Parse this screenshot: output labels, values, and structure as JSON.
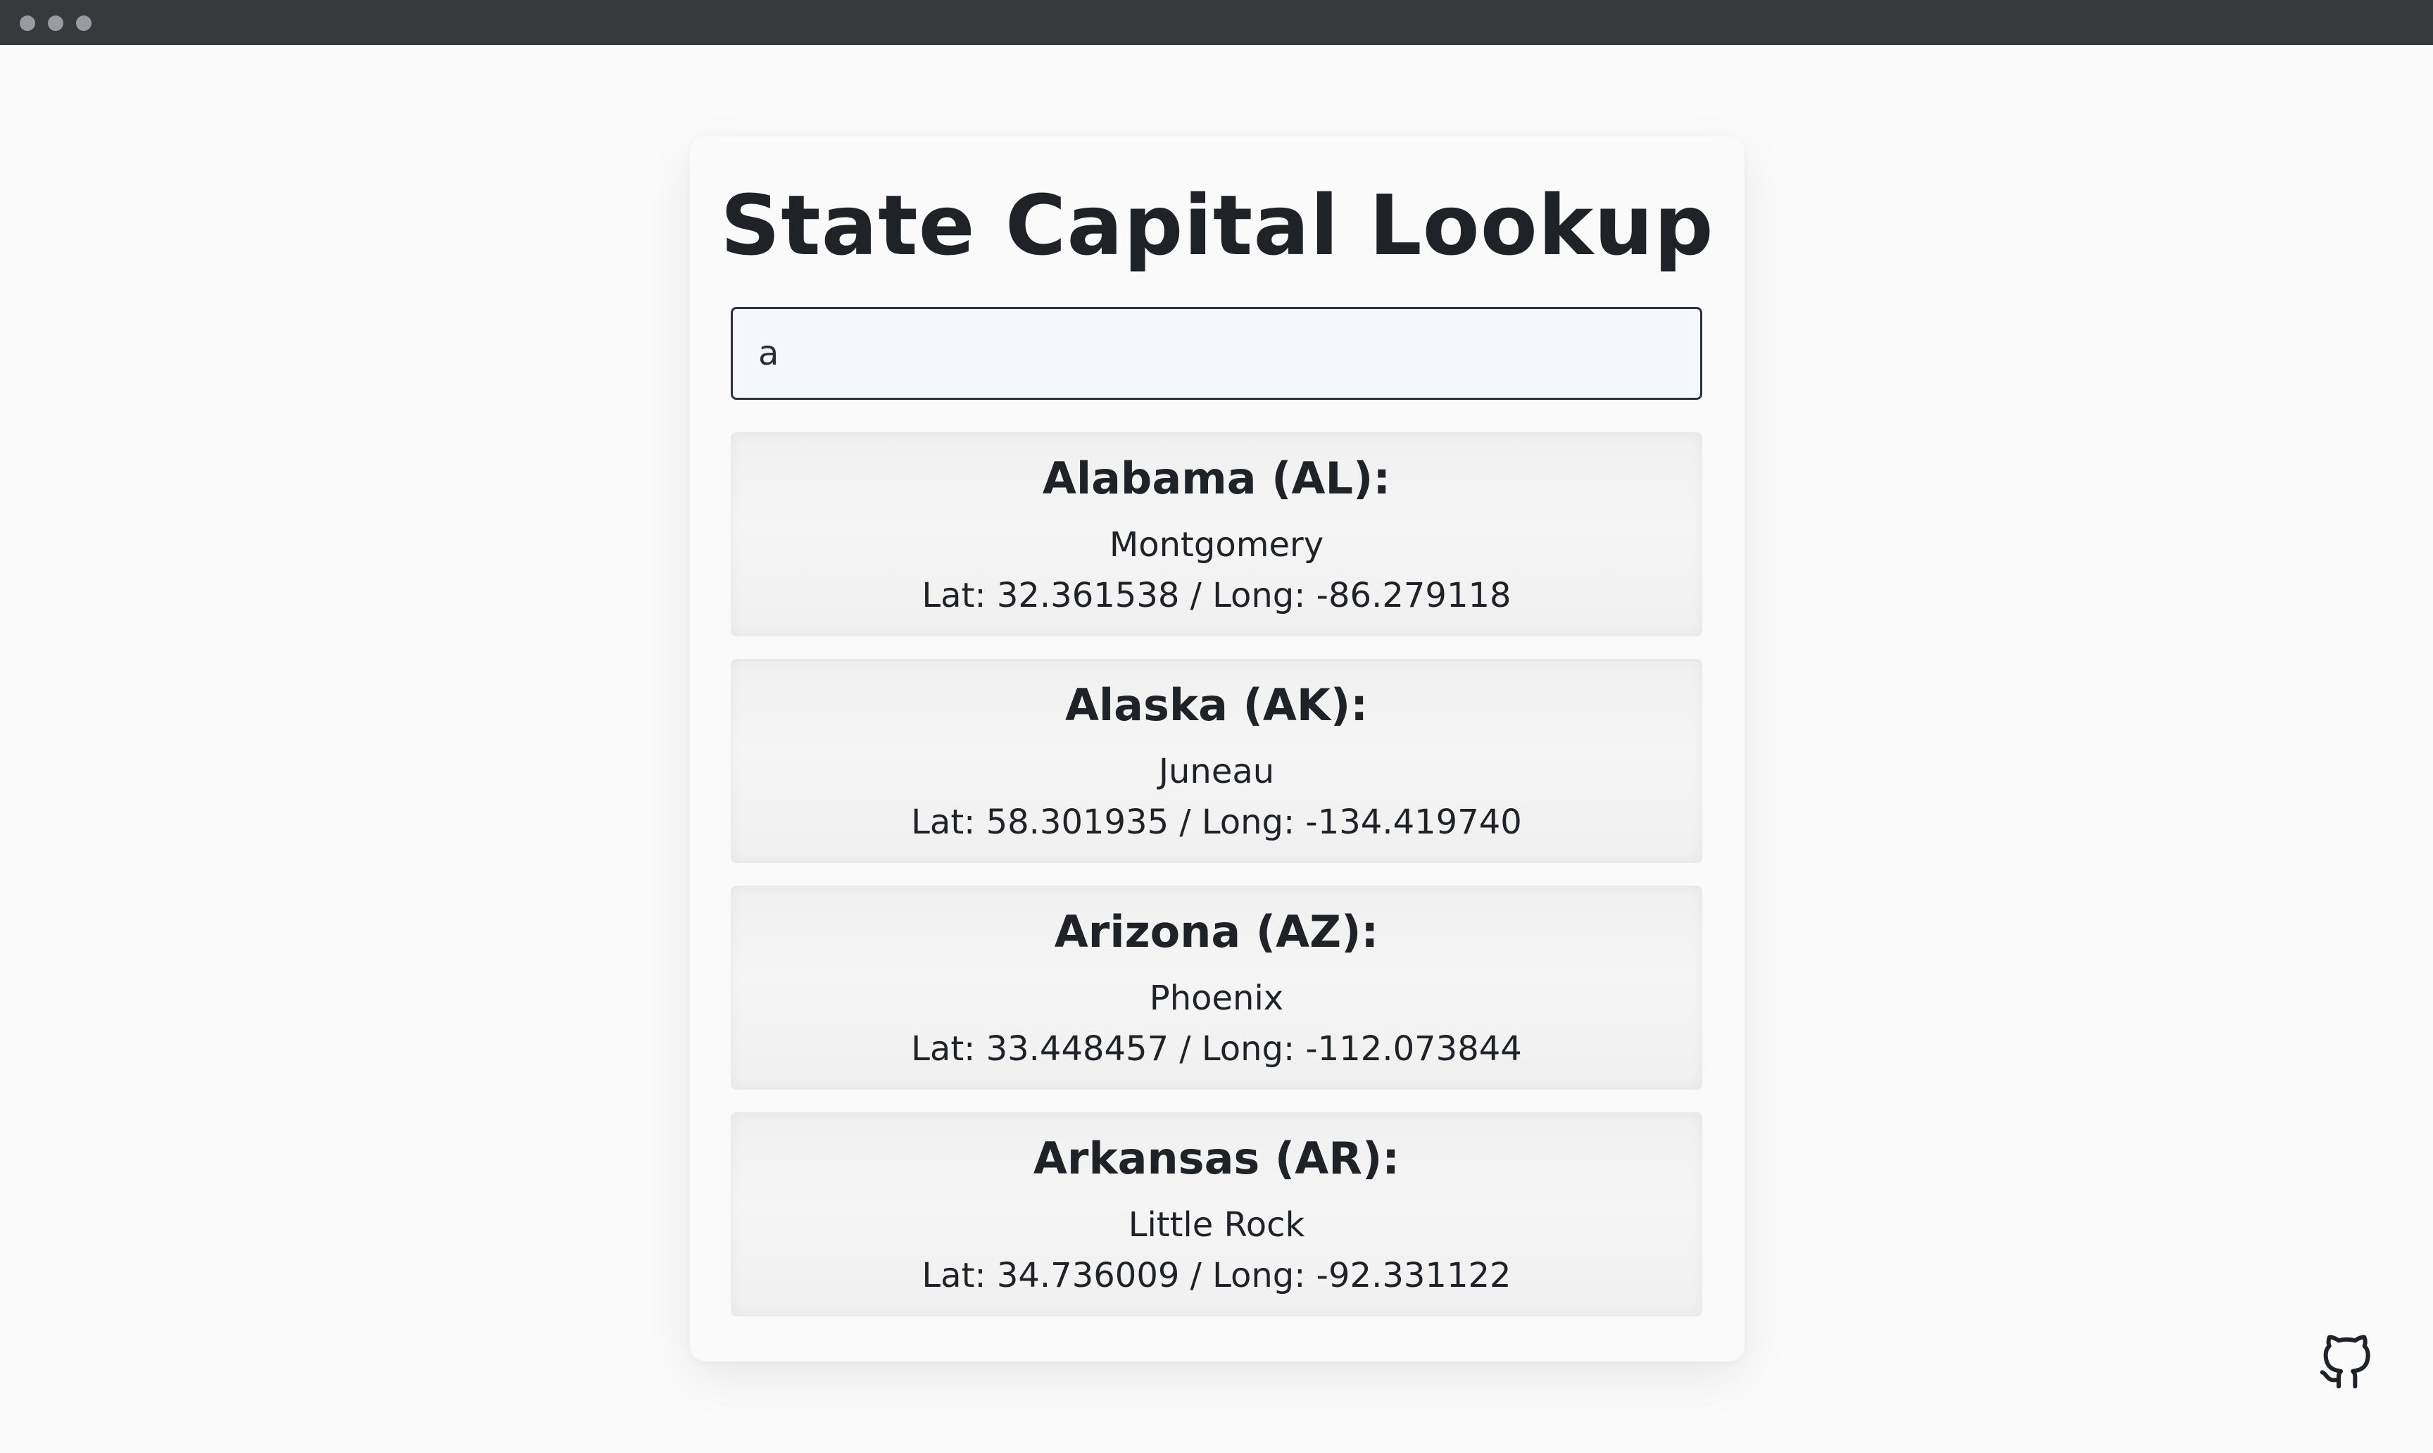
{
  "app": {
    "title": "State Capital Lookup"
  },
  "search": {
    "value": "a",
    "placeholder": ""
  },
  "results": [
    {
      "heading": "Alabama (AL):",
      "capital": "Montgomery",
      "coords": "Lat: 32.361538 / Long: -86.279118"
    },
    {
      "heading": "Alaska (AK):",
      "capital": "Juneau",
      "coords": "Lat: 58.301935 / Long: -134.419740"
    },
    {
      "heading": "Arizona (AZ):",
      "capital": "Phoenix",
      "coords": "Lat: 33.448457 / Long: -112.073844"
    },
    {
      "heading": "Arkansas (AR):",
      "capital": "Little Rock",
      "coords": "Lat: 34.736009 / Long: -92.331122"
    }
  ],
  "footer": {
    "github_icon": "github-icon"
  },
  "colors": {
    "titlebar": "#38393c",
    "background": "#fafafa",
    "input_border": "#2d3340",
    "input_background": "#f4f8fc",
    "text": "#1f2328"
  }
}
